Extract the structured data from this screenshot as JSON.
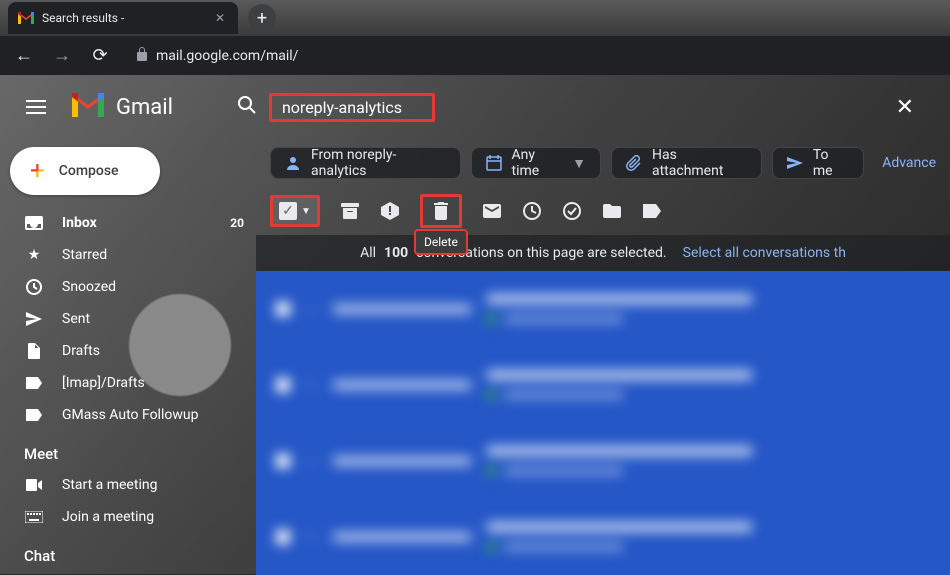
{
  "browser": {
    "tab_title": "Search results -",
    "url": "mail.google.com/mail/"
  },
  "header": {
    "app_name": "Gmail",
    "search_value": "noreply-analytics"
  },
  "compose_label": "Compose",
  "sidebar": {
    "items": [
      {
        "icon": "inbox",
        "label": "Inbox",
        "count": "20"
      },
      {
        "icon": "star",
        "label": "Starred",
        "count": ""
      },
      {
        "icon": "clock",
        "label": "Snoozed",
        "count": ""
      },
      {
        "icon": "send",
        "label": "Sent",
        "count": ""
      },
      {
        "icon": "file",
        "label": "Drafts",
        "count": ""
      },
      {
        "icon": "label",
        "label": "[Imap]/Drafts",
        "count": ""
      },
      {
        "icon": "label",
        "label": "GMass Auto Followup",
        "count": ""
      }
    ],
    "meet_label": "Meet",
    "meet_items": [
      {
        "icon": "video",
        "label": "Start a meeting"
      },
      {
        "icon": "keyboard",
        "label": "Join a meeting"
      }
    ],
    "chat_label": "Chat"
  },
  "chips": [
    {
      "icon": "person",
      "label": "From noreply-analytics"
    },
    {
      "icon": "calendar",
      "label": "Any time",
      "dropdown": true
    },
    {
      "icon": "attach",
      "label": "Has attachment"
    },
    {
      "icon": "to",
      "label": "To me"
    }
  ],
  "advanced_label": "Advance",
  "toolbar": {
    "delete_tooltip": "Delete"
  },
  "selection_bar": {
    "prefix": "All ",
    "count": "100",
    "suffix": " conversations on this page are selected.",
    "link": "Select all conversations th"
  }
}
